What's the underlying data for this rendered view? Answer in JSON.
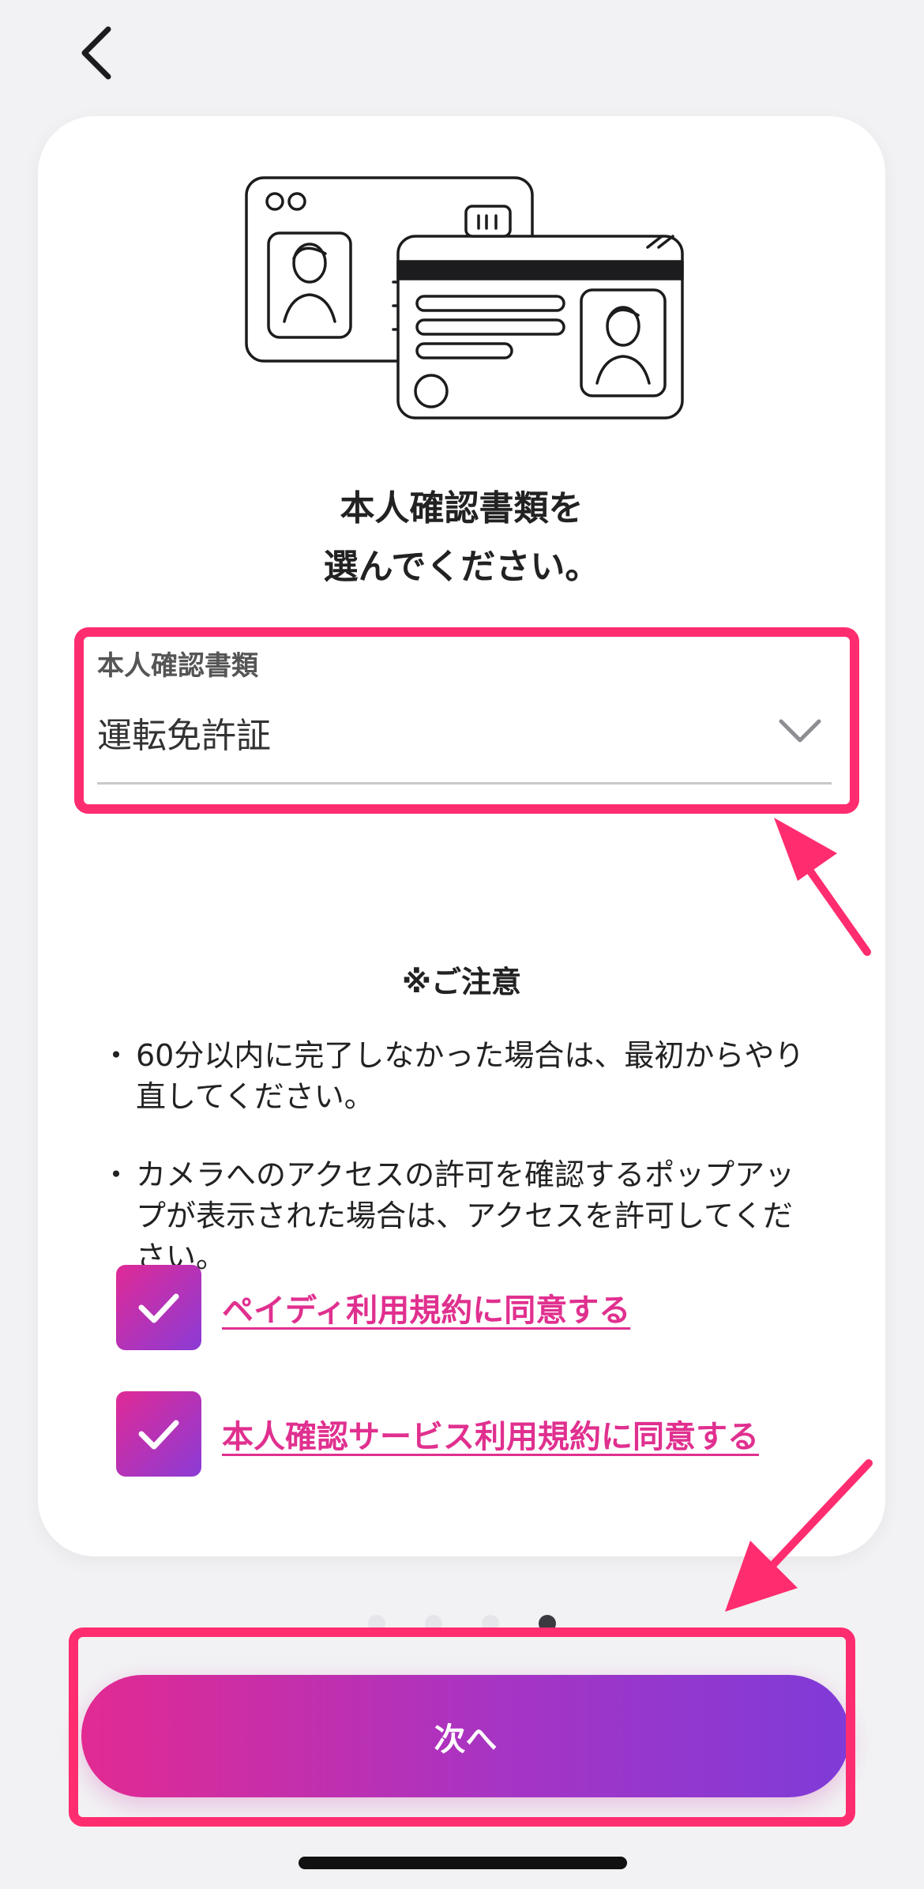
{
  "header": {
    "back_icon": "chevron-left-icon"
  },
  "card": {
    "title_line1": "本人確認書類を",
    "title_line2": "選んでください。",
    "document_select": {
      "label": "本人確認書類",
      "value": "運転免許証",
      "icon": "chevron-down-icon"
    },
    "notice": {
      "title": "※ご注意",
      "items": [
        "60分以内に完了しなかった場合は、最初からやり直してください。",
        "カメラへのアクセスの許可を確認するポップアップが表示された場合は、アクセスを許可してください。"
      ]
    },
    "agreements": [
      {
        "label": "ペイディ利用規約に同意する",
        "checked": true
      },
      {
        "label": "本人確認サービス利用規約に同意する",
        "checked": true
      }
    ]
  },
  "pagination": {
    "total": 4,
    "current": 4
  },
  "next_button": {
    "label": "次へ"
  },
  "colors": {
    "accent_pink": "#e0308f",
    "gradient_start": "#e22a92",
    "gradient_end": "#7f3bd8",
    "highlight": "#ff2d6f"
  }
}
